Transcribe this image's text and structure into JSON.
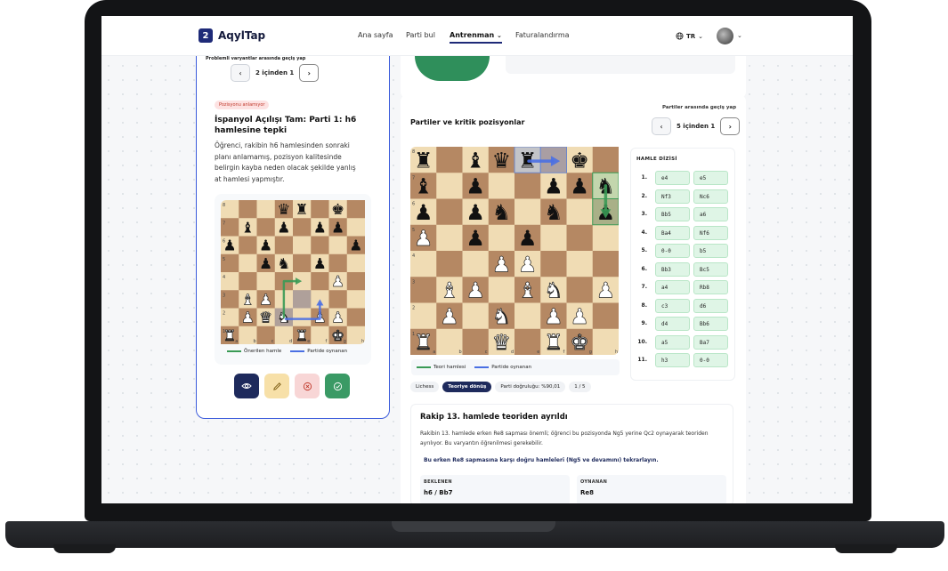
{
  "nav": {
    "logo_mark": "2",
    "logo_text": "AqylTap",
    "links": [
      {
        "label": "Ana sayfa",
        "active": false
      },
      {
        "label": "Parti bul",
        "active": false
      },
      {
        "label": "Antrenman",
        "active": true
      },
      {
        "label": "Faturalandırma",
        "active": false
      }
    ],
    "language": "TR"
  },
  "left_card": {
    "variant_hint": "Problemli varyantlar arasında geçiş yap",
    "pager_label": "2 içinden 1",
    "badge": "Pozisyonu anlamıyor",
    "title": "İspanyol Açılışı Tam: Parti 1: h6 hamlesine tepki",
    "description": "Öğrenci, rakibin h6 hamlesinden sonraki planı anlamamış, pozisyon kalitesinde belirgin kayba neden olacak şekilde yanlış at hamlesi yapmıştır.",
    "legend_suggested": "Önerilen hamle",
    "legend_played": "Partide oynanan",
    "colors": {
      "suggested": "#3a9a55",
      "played": "#4a6fe3"
    }
  },
  "right": {
    "section_title": "Partiler ve kritik pozisyonlar",
    "switch_hint": "Partiler arasında geçiş yap",
    "pager_label": "5 içinden 1",
    "legend_theory": "Teori hamlesi",
    "legend_played": "Partide oynanan",
    "chips": [
      "Lichess",
      "Teoriye dönüş",
      "Parti doğruluğu: %90,01",
      "1 / 5"
    ],
    "move_list_title": "HAMLE DİZİSİ",
    "moves": [
      [
        "1.",
        "e4",
        "e5"
      ],
      [
        "2.",
        "Nf3",
        "Nc6"
      ],
      [
        "3.",
        "Bb5",
        "a6"
      ],
      [
        "4.",
        "Ba4",
        "Nf6"
      ],
      [
        "5.",
        "0-0",
        "b5"
      ],
      [
        "6.",
        "Bb3",
        "Bc5"
      ],
      [
        "7.",
        "a4",
        "Rb8"
      ],
      [
        "8.",
        "c3",
        "d6"
      ],
      [
        "9.",
        "d4",
        "Bb6"
      ],
      [
        "10.",
        "a5",
        "Ba7"
      ],
      [
        "11.",
        "h3",
        "0-0"
      ]
    ],
    "info": {
      "title": "Rakip 13. hamlede teoriden ayrıldı",
      "description": "Rakibin 13. hamlede erken Re8 sapması önemli; öğrenci bu pozisyonda Ng5 yerine Qc2 oynayarak teoriden ayrılıyor. Bu varyantın öğrenilmesi gerekebilir.",
      "recommendation": "Bu erken Re8 sapmasına karşı doğru hamleleri (Ng5 ve devamını) tekrarlayın.",
      "expected_label": "BEKLENEN",
      "expected_value": "h6 / Bb7",
      "played_label": "OYNANAN",
      "played_value": "Re8"
    }
  },
  "boards": {
    "small": {
      "ranks": [
        "...qr.k.",
        ".b.p.pp.",
        "p.p....p",
        "..pn.p..",
        "......P.",
        ".BP.....",
        ".PQN.PP.",
        "R...R.K."
      ],
      "rank_labels": [
        "8",
        "7",
        "6",
        "5",
        "4",
        "3",
        "2",
        "1"
      ],
      "file_labels": [
        "a",
        "b",
        "c",
        "d",
        "e",
        "f",
        "g",
        "h"
      ]
    },
    "large": {
      "ranks": [
        "r.bqr.k.",
        "b.p..ppn",
        "p.pn.n.p",
        "P.p.p...",
        "...PP...",
        ".BP.BN.P",
        ".P.N.PP.",
        "R..Q.RK."
      ],
      "rank_labels": [
        "8",
        "7",
        "6",
        "5",
        "4",
        "3",
        "2",
        "1"
      ],
      "file_labels": [
        "a",
        "b",
        "c",
        "d",
        "e",
        "f",
        "g",
        "h"
      ]
    },
    "square_colors": {
      "light": "#f0dcb4",
      "dark": "#b58863"
    }
  }
}
